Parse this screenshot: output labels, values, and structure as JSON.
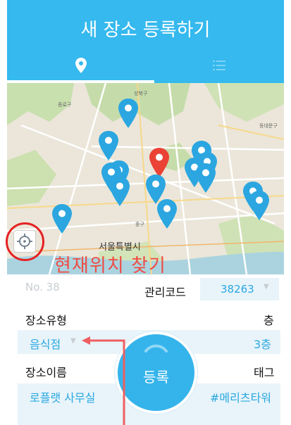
{
  "header": {
    "title": "새 장소 등록하기"
  },
  "tabs": [
    {
      "icon": "map-marker-icon",
      "active": true
    },
    {
      "icon": "list-icon",
      "active": false
    }
  ],
  "map": {
    "city_label": "서울특별시",
    "district_labels": [
      "종로구",
      "성북구",
      "동대문구",
      "중구"
    ]
  },
  "annotation": {
    "locate_text": "현재위치 찾기"
  },
  "form": {
    "number": "No. 38",
    "management_code_label": "관리코드",
    "management_code_value": "38263",
    "place_type_label": "장소유형",
    "floor_label": "층",
    "place_type_value": "음식점",
    "floor_value": "3층",
    "place_name_label": "장소이름",
    "tag_label": "태그",
    "place_name_value": "로플랫 사무실",
    "tag_value": "#메리츠타워"
  },
  "register_button": {
    "label": "등록"
  },
  "colors": {
    "accent": "#35b9ee",
    "annotation": "#ef4c45",
    "pin_blue": "#2ba6e0",
    "pin_red": "#ea4335"
  }
}
